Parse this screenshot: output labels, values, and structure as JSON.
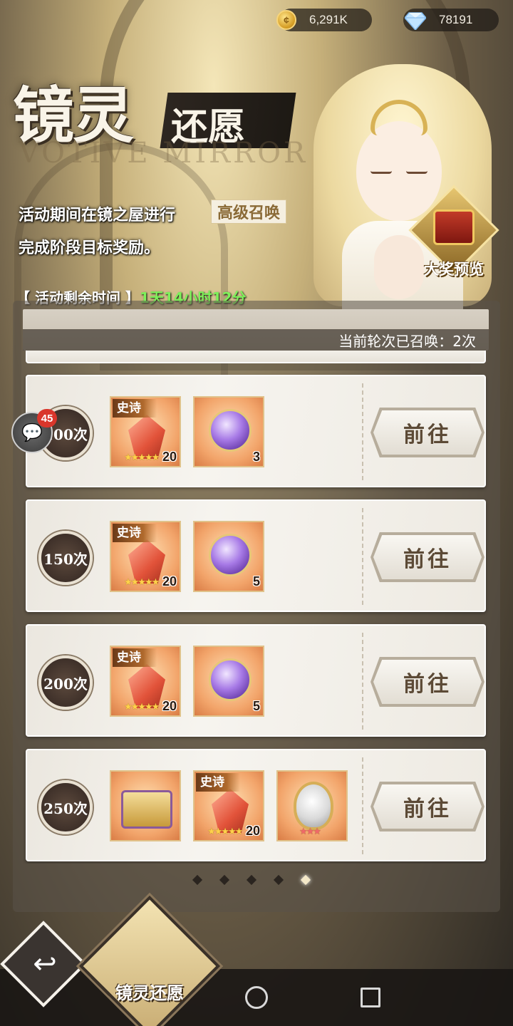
{
  "currency": {
    "gold_value": "6,291K",
    "gold_icon": "coin-icon",
    "gem_value": "78191",
    "gem_icon": "diamond-icon"
  },
  "header": {
    "title_main": "镜灵",
    "title_secondary": "还愿",
    "subtitle_en": "VOTIVE MIRROR"
  },
  "description": {
    "line1": "活动期间在镜之屋进行",
    "highlight": "高级召唤",
    "line2": "完成阶段目标奖励。"
  },
  "timer": {
    "label": "【 活动剩余时间 】",
    "value": "1天14小时12分"
  },
  "grand_prize": {
    "label": "大奖预览"
  },
  "panel": {
    "round_status": "当前轮次已召唤：2次"
  },
  "chat": {
    "badge": "45"
  },
  "rows": [
    {
      "milestone": "100次",
      "items": [
        {
          "type": "shard",
          "tag": "史诗",
          "count": "20",
          "stars": "★★★★★"
        },
        {
          "type": "orb",
          "count": "3"
        }
      ],
      "button": "前往"
    },
    {
      "milestone": "150次",
      "items": [
        {
          "type": "shard",
          "tag": "史诗",
          "count": "20",
          "stars": "★★★★★"
        },
        {
          "type": "orb",
          "count": "5"
        }
      ],
      "button": "前往"
    },
    {
      "milestone": "200次",
      "items": [
        {
          "type": "shard",
          "tag": "史诗",
          "count": "20",
          "stars": "★★★★★"
        },
        {
          "type": "orb",
          "count": "5"
        }
      ],
      "button": "前往"
    },
    {
      "milestone": "250次",
      "items": [
        {
          "type": "chest"
        },
        {
          "type": "shard",
          "tag": "史诗",
          "count": "20",
          "stars": "★★★★★"
        },
        {
          "type": "mirror",
          "stars": "★★★"
        }
      ],
      "button": "前往"
    }
  ],
  "pagination": {
    "total": 5,
    "active_index": 4
  },
  "bottom": {
    "back_icon": "return-arrow-icon",
    "tab_label": "镜灵还愿"
  },
  "system_nav": {
    "back_icon": "nav-back-icon",
    "home_icon": "nav-home-icon",
    "recent_icon": "nav-recent-icon"
  }
}
